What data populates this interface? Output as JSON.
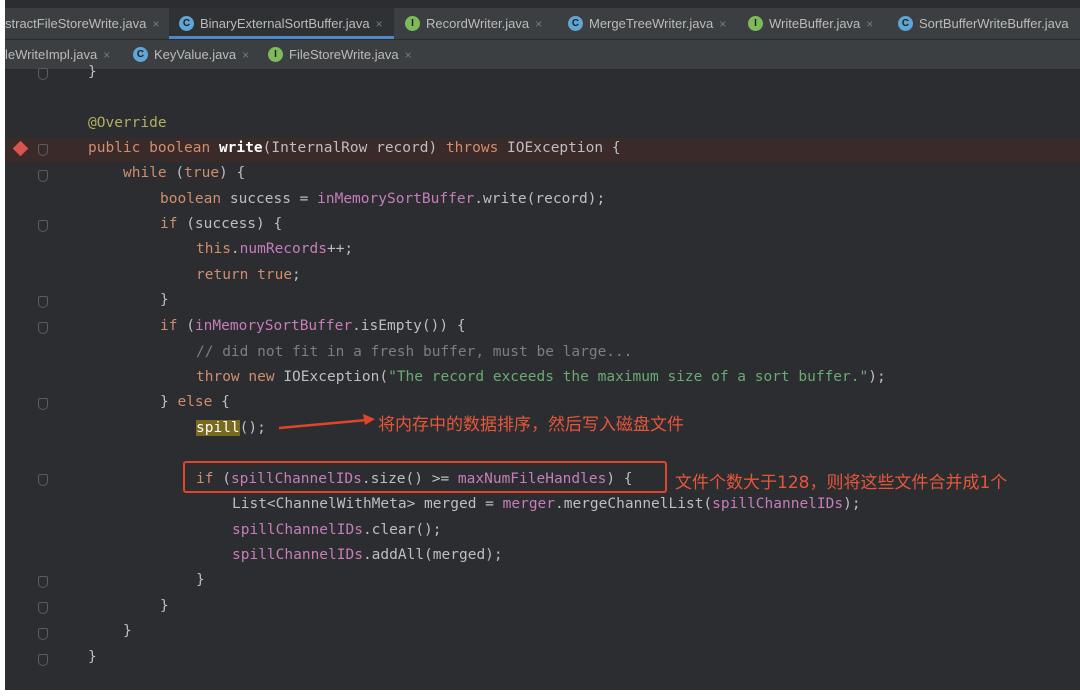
{
  "tabs_row1": [
    {
      "label": "stractFileStoreWrite.java",
      "icon": "none",
      "active": false
    },
    {
      "label": "BinaryExternalSortBuffer.java",
      "icon": "class-icon",
      "active": true
    },
    {
      "label": "RecordWriter.java",
      "icon": "interface-icon",
      "active": false
    },
    {
      "label": "MergeTreeWriter.java",
      "icon": "class-icon",
      "active": false
    },
    {
      "label": "WriteBuffer.java",
      "icon": "interface-icon",
      "active": false
    },
    {
      "label": "SortBufferWriteBuffer.java",
      "icon": "class-icon",
      "active": false
    }
  ],
  "tabs_row2": [
    {
      "label": "leWriteImpl.java",
      "icon": "none",
      "active": false
    },
    {
      "label": "KeyValue.java",
      "icon": "class-icon",
      "active": false
    },
    {
      "label": "FileStoreWrite.java",
      "icon": "interface-icon",
      "active": false
    }
  ],
  "icon_glyphs": {
    "class": "C",
    "interface": "I",
    "close": "×"
  },
  "code": {
    "l0": "}",
    "l1_ann": "@Override",
    "l2_a": "public boolean ",
    "l2_fn": "write",
    "l2_b": "(InternalRow record) ",
    "l2_kw": "throws",
    "l2_c": " IOException {",
    "l3_kw": "while",
    "l3_a": " (",
    "l3_kw2": "true",
    "l3_b": ") {",
    "l4_kw": "boolean",
    "l4_a": " success = ",
    "l4_f": "inMemorySortBuffer",
    "l4_b": ".write(record);",
    "l5_kw": "if",
    "l5_a": " (success) {",
    "l6_kw": "this",
    "l6_a": ".",
    "l6_f": "numRecords",
    "l6_b": "++;",
    "l7_kw": "return",
    "l7_a": " ",
    "l7_kw2": "true",
    "l7_b": ";",
    "l8": "}",
    "l9_kw": "if",
    "l9_a": " (",
    "l9_f": "inMemorySortBuffer",
    "l9_b": ".isEmpty()) {",
    "l10_cmt": "// did not fit in a fresh buffer, must be large...",
    "l11_kw": "throw",
    "l11_a": " ",
    "l11_kw2": "new",
    "l11_b": " IOException(",
    "l11_str": "\"The record exceeds the maximum size of a sort buffer.\"",
    "l11_c": ");",
    "l12_a": "} ",
    "l12_kw": "else",
    "l12_b": " {",
    "l13_hl": "spill",
    "l13_a": "();",
    "l14_kw": "if",
    "l14_a": " (",
    "l14_f": "spillChannelIDs",
    "l14_b": ".size() >= ",
    "l14_f2": "maxNumFileHandles",
    "l14_c": ") {",
    "l15_a": "List<ChannelWithMeta> merged = ",
    "l15_f": "merger",
    "l15_b": ".mergeChannelList(",
    "l15_f2": "spillChannelIDs",
    "l15_c": ");",
    "l16_f": "spillChannelIDs",
    "l16_a": ".clear();",
    "l17_f": "spillChannelIDs",
    "l17_a": ".addAll(merged);",
    "l18": "}",
    "l19": "}",
    "l20": "}",
    "l21": "}"
  },
  "annotations": {
    "spill_note": "将内存中的数据排序，然后写入磁盘文件",
    "merge_note": "文件个数大于128，则将这些文件合并成1个"
  },
  "colors": {
    "annotation_red": "#e0452a",
    "keyword": "#cf8e6d",
    "field": "#c77dbb",
    "string": "#6aab73"
  }
}
